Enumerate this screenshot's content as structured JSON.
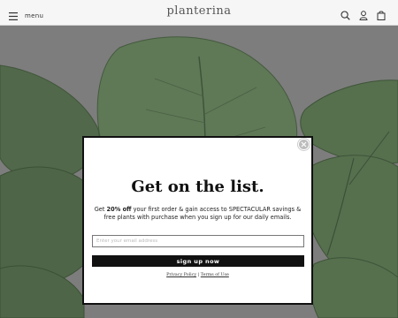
{
  "header": {
    "menu_label": "menu",
    "brand": "planterina",
    "icons": [
      "hamburger-menu-icon",
      "search-icon",
      "account-icon",
      "cart-bag-icon"
    ]
  },
  "popup": {
    "title": "Get on the list.",
    "body_prefix": "Get ",
    "body_bold": "20% off",
    "body_suffix": " your first order & gain access to SPECTACULAR savings & free plants with purchase when you sign up for our daily emails.",
    "email_placeholder": "Enter your email address",
    "email_value": "",
    "submit_label": "sign up now",
    "privacy_link": "Privacy Policy",
    "separator": "|",
    "terms_link": "Terms of Use"
  },
  "colors": {
    "header_bg": "#f6f6f6",
    "overlay": "#7a7a7a",
    "button_bg": "#111111",
    "leaf": "#5a7251"
  }
}
